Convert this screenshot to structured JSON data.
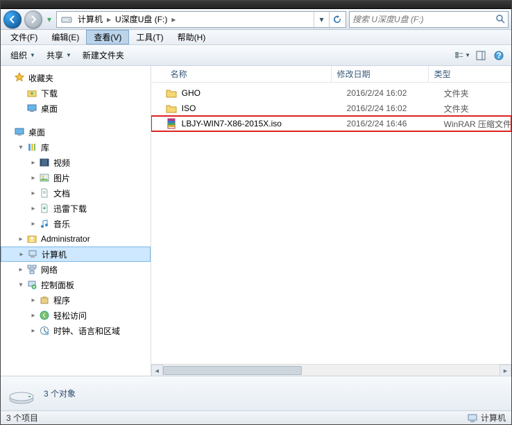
{
  "address": {
    "icon": "drive",
    "crumbs": [
      "计算机",
      "U深度U盘 (F:)"
    ],
    "search_placeholder": "搜索 U深度U盘 (F:)"
  },
  "menu": {
    "file": "文件(F)",
    "edit": "编辑(E)",
    "view": "查看(V)",
    "tools": "工具(T)",
    "help": "帮助(H)"
  },
  "toolbar": {
    "organize": "组织",
    "share": "共享",
    "newfolder": "新建文件夹"
  },
  "columns": {
    "name": "名称",
    "date": "修改日期",
    "type": "类型"
  },
  "files": [
    {
      "icon": "folder",
      "name": "GHO",
      "date": "2016/2/24 16:02",
      "type": "文件夹",
      "highlight": false
    },
    {
      "icon": "folder",
      "name": "ISO",
      "date": "2016/2/24 16:02",
      "type": "文件夹",
      "highlight": false
    },
    {
      "icon": "rar",
      "name": "LBJY-WIN7-X86-2015X.iso",
      "date": "2016/2/24 16:46",
      "type": "WinRAR 压缩文件",
      "highlight": true
    }
  ],
  "tree": {
    "favorites": {
      "label": "收藏夹",
      "items": [
        {
          "icon": "download",
          "label": "下载"
        },
        {
          "icon": "desktop",
          "label": "桌面"
        }
      ]
    },
    "desktop": {
      "label": "桌面",
      "items": [
        {
          "icon": "library",
          "label": "库",
          "expanded": true,
          "children": [
            {
              "icon": "video",
              "label": "视频"
            },
            {
              "icon": "picture",
              "label": "图片"
            },
            {
              "icon": "document",
              "label": "文档"
            },
            {
              "icon": "xunlei",
              "label": "迅雷下载"
            },
            {
              "icon": "music",
              "label": "音乐"
            }
          ]
        },
        {
          "icon": "user",
          "label": "Administrator"
        },
        {
          "icon": "computer",
          "label": "计算机",
          "selected": true
        },
        {
          "icon": "network",
          "label": "网络"
        },
        {
          "icon": "controlpanel",
          "label": "控制面板",
          "expanded": true,
          "children": [
            {
              "icon": "programs",
              "label": "程序"
            },
            {
              "icon": "ease",
              "label": "轻松访问"
            },
            {
              "icon": "clock",
              "label": "时钟、语言和区域"
            }
          ]
        }
      ]
    }
  },
  "details": {
    "count_label": "3 个对象"
  },
  "status": {
    "items": "3 个项目",
    "computer": "计算机"
  }
}
